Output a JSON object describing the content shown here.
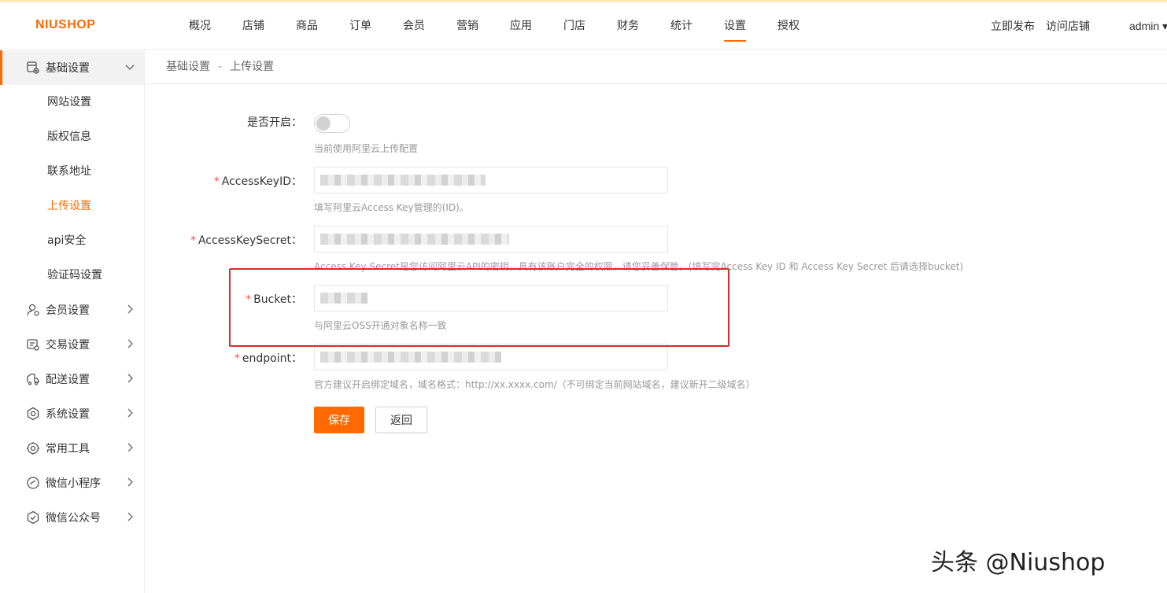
{
  "logo": "NIUSHOP",
  "nav": [
    {
      "label": "概况",
      "active": false
    },
    {
      "label": "店铺",
      "active": false
    },
    {
      "label": "商品",
      "active": false
    },
    {
      "label": "订单",
      "active": false
    },
    {
      "label": "会员",
      "active": false
    },
    {
      "label": "营销",
      "active": false
    },
    {
      "label": "应用",
      "active": false
    },
    {
      "label": "门店",
      "active": false
    },
    {
      "label": "财务",
      "active": false
    },
    {
      "label": "统计",
      "active": false
    },
    {
      "label": "设置",
      "active": true
    },
    {
      "label": "授权",
      "active": false
    }
  ],
  "header_right": {
    "publish": "立即发布",
    "visit_store": "访问店铺",
    "user": "admin ▾"
  },
  "sidebar": {
    "groups": [
      {
        "label": "基础设置",
        "icon": "settings-basic-icon",
        "expanded": true,
        "items": [
          {
            "label": "网站设置",
            "active": false
          },
          {
            "label": "版权信息",
            "active": false
          },
          {
            "label": "联系地址",
            "active": false
          },
          {
            "label": "上传设置",
            "active": true
          },
          {
            "label": "api安全",
            "active": false
          },
          {
            "label": "验证码设置",
            "active": false
          }
        ]
      },
      {
        "label": "会员设置",
        "icon": "member-icon",
        "expanded": false
      },
      {
        "label": "交易设置",
        "icon": "trade-icon",
        "expanded": false
      },
      {
        "label": "配送设置",
        "icon": "delivery-icon",
        "expanded": false
      },
      {
        "label": "系统设置",
        "icon": "gear-icon",
        "expanded": false
      },
      {
        "label": "常用工具",
        "icon": "tools-icon",
        "expanded": false
      },
      {
        "label": "微信小程序",
        "icon": "miniprogram-icon",
        "expanded": false
      },
      {
        "label": "微信公众号",
        "icon": "official-account-icon",
        "expanded": false
      }
    ]
  },
  "breadcrumb": {
    "parent": "基础设置",
    "separator": "-",
    "current": "上传设置"
  },
  "form": {
    "enable": {
      "label": "是否开启：",
      "on": false,
      "help": "当前使用阿里云上传配置"
    },
    "access_key_id": {
      "required_mark": "*",
      "label": "AccessKeyID：",
      "help": "填写阿里云Access Key管理的(ID)。"
    },
    "access_key_secret": {
      "required_mark": "*",
      "label": "AccessKeySecret：",
      "help": "Access Key Secret是您访问阿里云API的密钥，具有该账户完全的权限，请您妥善保管。(填写完Access Key ID 和 Access Key Secret 后请选择bucket)"
    },
    "bucket": {
      "required_mark": "*",
      "label": "Bucket：",
      "help": "与阿里云OSS开通对象名称一致"
    },
    "endpoint": {
      "required_mark": "*",
      "label": "endpoint：",
      "help": "官方建议开启绑定域名，域名格式：http://xx.xxxx.com/（不可绑定当前网站域名，建议新开二级域名）"
    },
    "save_label": "保存",
    "back_label": "返回"
  },
  "watermark": "头条 @Niushop",
  "colors": {
    "accent": "#ff6a00",
    "highlight_border": "#e0272a",
    "required": "#ff4d4f"
  }
}
